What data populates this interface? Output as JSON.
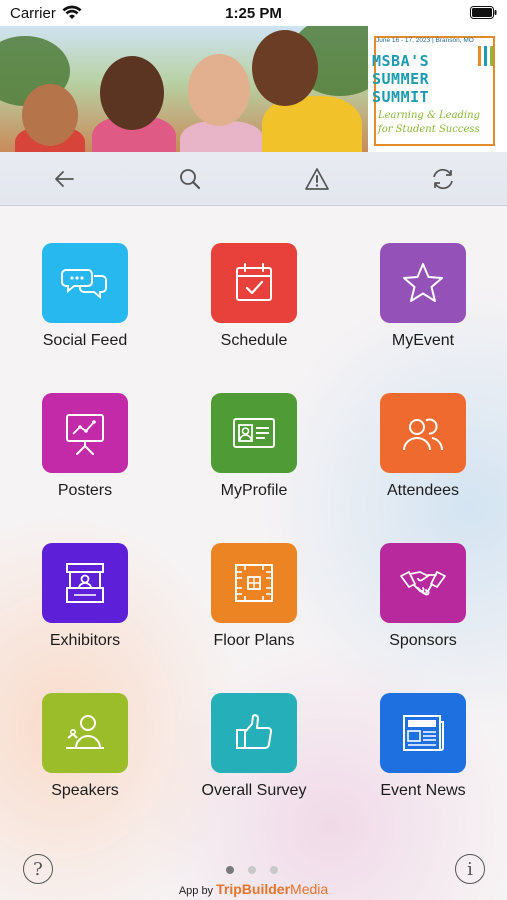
{
  "status_bar": {
    "carrier": "Carrier",
    "time": "1:25 PM"
  },
  "banner": {
    "date_line": "June 16 - 17, 2023  |  Branson, MO",
    "title_1": "MSBA'S",
    "title_2": "SUMMER",
    "title_3": "SUMMIT",
    "subtitle_1": "Learning & Leading",
    "subtitle_2": "for Student Success"
  },
  "toolbar": {
    "back": "back-arrow-icon",
    "search": "search-icon",
    "alert": "warning-icon",
    "refresh": "refresh-icon"
  },
  "tiles": [
    {
      "label": "Social Feed",
      "color": "#28b8f0",
      "icon": "chat-bubbles-icon"
    },
    {
      "label": "Schedule",
      "color": "#e8403a",
      "icon": "calendar-check-icon"
    },
    {
      "label": "MyEvent",
      "color": "#9452b8",
      "icon": "star-icon"
    },
    {
      "label": "Posters",
      "color": "#c22aa8",
      "icon": "presentation-board-icon"
    },
    {
      "label": "MyProfile",
      "color": "#4f9b35",
      "icon": "id-card-icon"
    },
    {
      "label": "Attendees",
      "color": "#ef6a2f",
      "icon": "people-icon"
    },
    {
      "label": "Exhibitors",
      "color": "#5d1fd8",
      "icon": "booth-icon"
    },
    {
      "label": "Floor Plans",
      "color": "#ed8424",
      "icon": "floor-plan-icon"
    },
    {
      "label": "Sponsors",
      "color": "#b7299d",
      "icon": "handshake-icon"
    },
    {
      "label": "Speakers",
      "color": "#9cbd2a",
      "icon": "speaker-podium-icon"
    },
    {
      "label": "Overall Survey",
      "color": "#25b0b9",
      "icon": "thumbs-up-icon"
    },
    {
      "label": "Event News",
      "color": "#1e6fe0",
      "icon": "newspaper-icon"
    }
  ],
  "footer": {
    "help": "?",
    "info": "i",
    "page_count": 3,
    "active_page": 1,
    "credit_prefix": "App by",
    "credit_brand": "TripBuilder",
    "credit_brand_2": "Media"
  }
}
